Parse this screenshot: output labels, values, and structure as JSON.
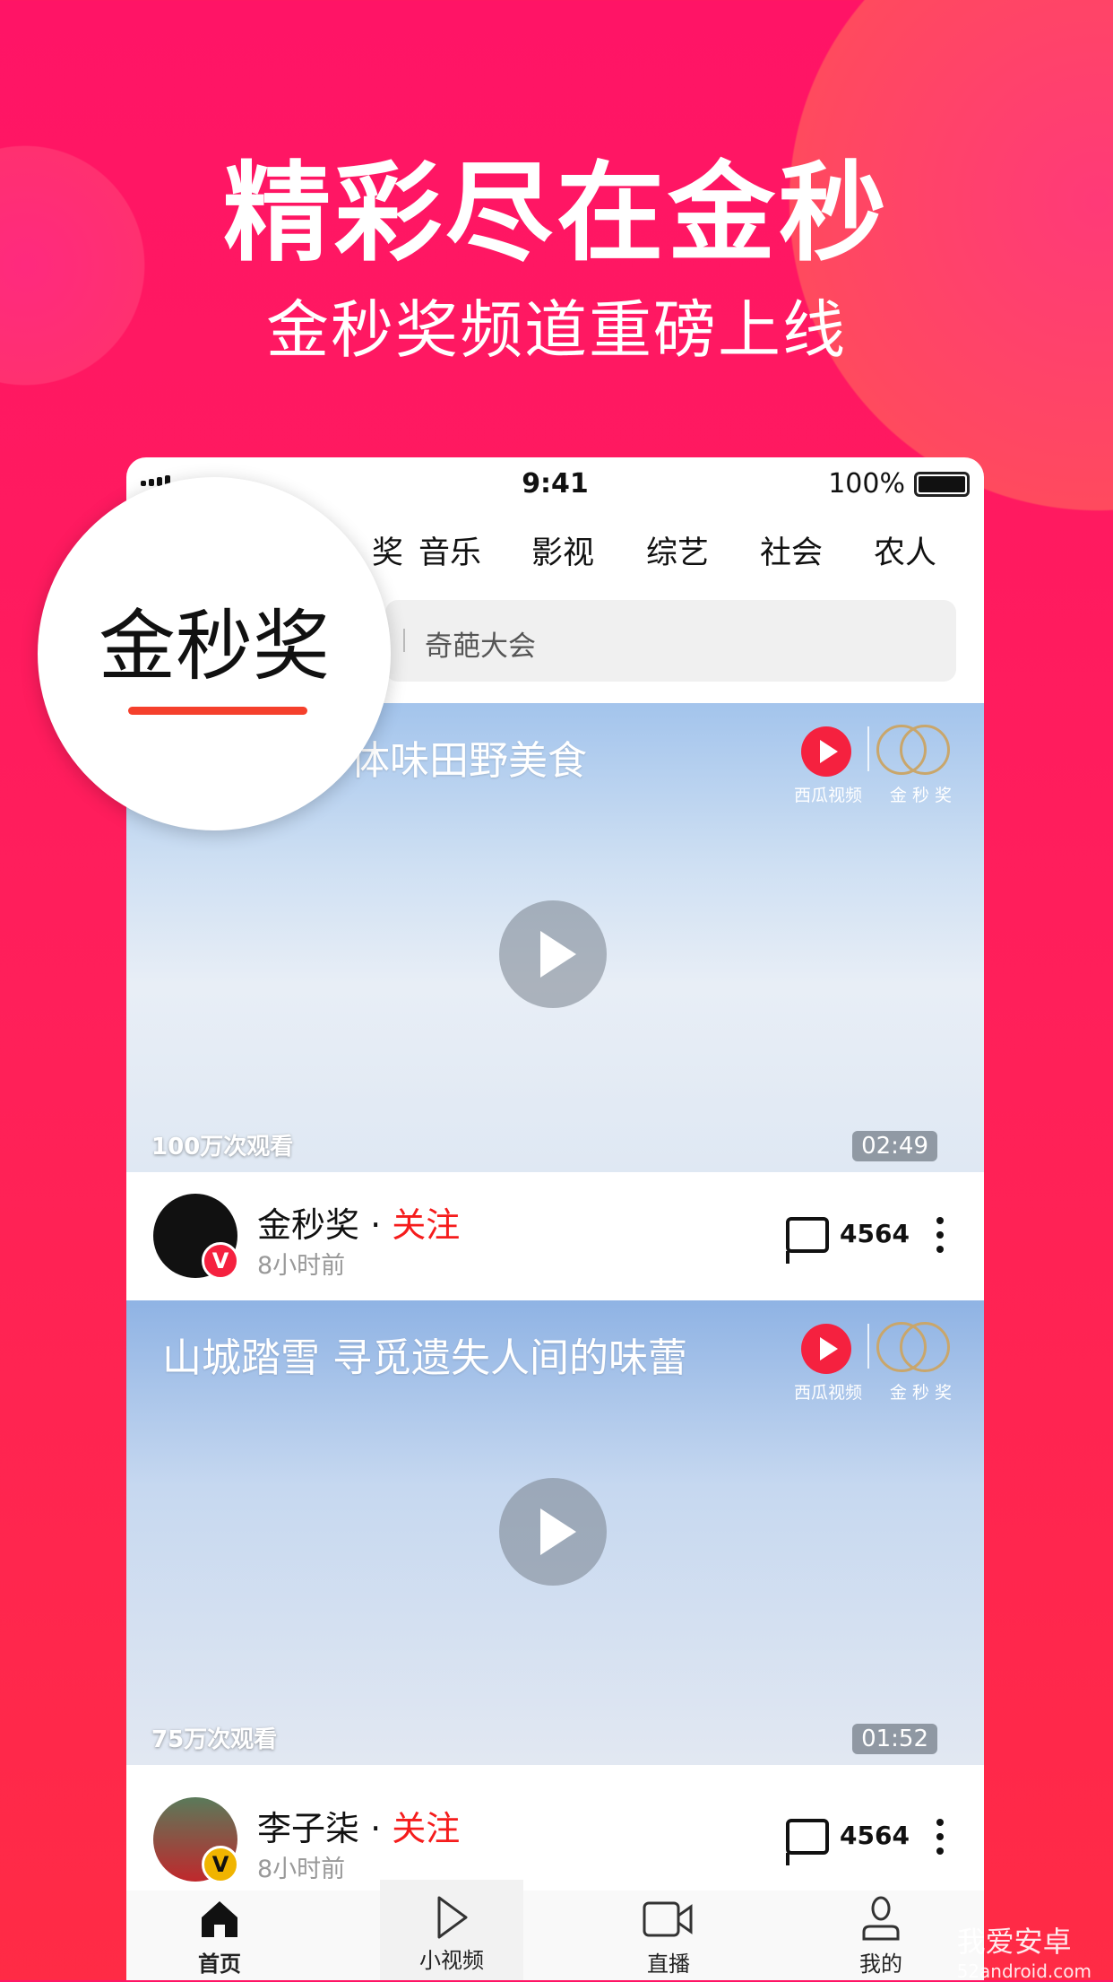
{
  "promo": {
    "headline": "精彩尽在金秒",
    "subheadline": "金秒奖频道重磅上线"
  },
  "status_bar": {
    "time": "9:41",
    "battery": "100%"
  },
  "tabs": [
    "奖",
    "音乐",
    "影视",
    "综艺",
    "社会",
    "农人"
  ],
  "magnifier": {
    "label": "金秒奖"
  },
  "search": {
    "placeholder": "奇葩大会"
  },
  "feed": [
    {
      "title": "体味田野美食",
      "views": "100万次观看",
      "duration": "02:49",
      "author": "金秒奖",
      "follow": "关注",
      "time_ago": "8小时前",
      "comments": "4564",
      "badge": "V",
      "badge_color": "#f5213f"
    },
    {
      "title": "山城踏雪  寻觅遗失人间的味蕾",
      "views": "75万次观看",
      "duration": "01:52",
      "author": "李子柒",
      "follow": "关注",
      "time_ago": "8小时前",
      "comments": "4564",
      "badge": "V",
      "badge_color": "#f0b400"
    }
  ],
  "logos": {
    "xigua": "西瓜视频",
    "jinmiao": "金 秒 奖"
  },
  "bottom_nav": [
    {
      "label": "首页",
      "icon": "home-icon",
      "active": true
    },
    {
      "label": "小视频",
      "icon": "play-icon"
    },
    {
      "label": "直播",
      "icon": "video-camera-icon"
    },
    {
      "label": "我的",
      "icon": "user-icon"
    }
  ],
  "watermark": {
    "name": "我爱安卓",
    "url": "52android.com"
  },
  "colors": {
    "background": "#ff1f5a",
    "follow": "#f51c1c",
    "accent_underline": "#f5402c"
  }
}
